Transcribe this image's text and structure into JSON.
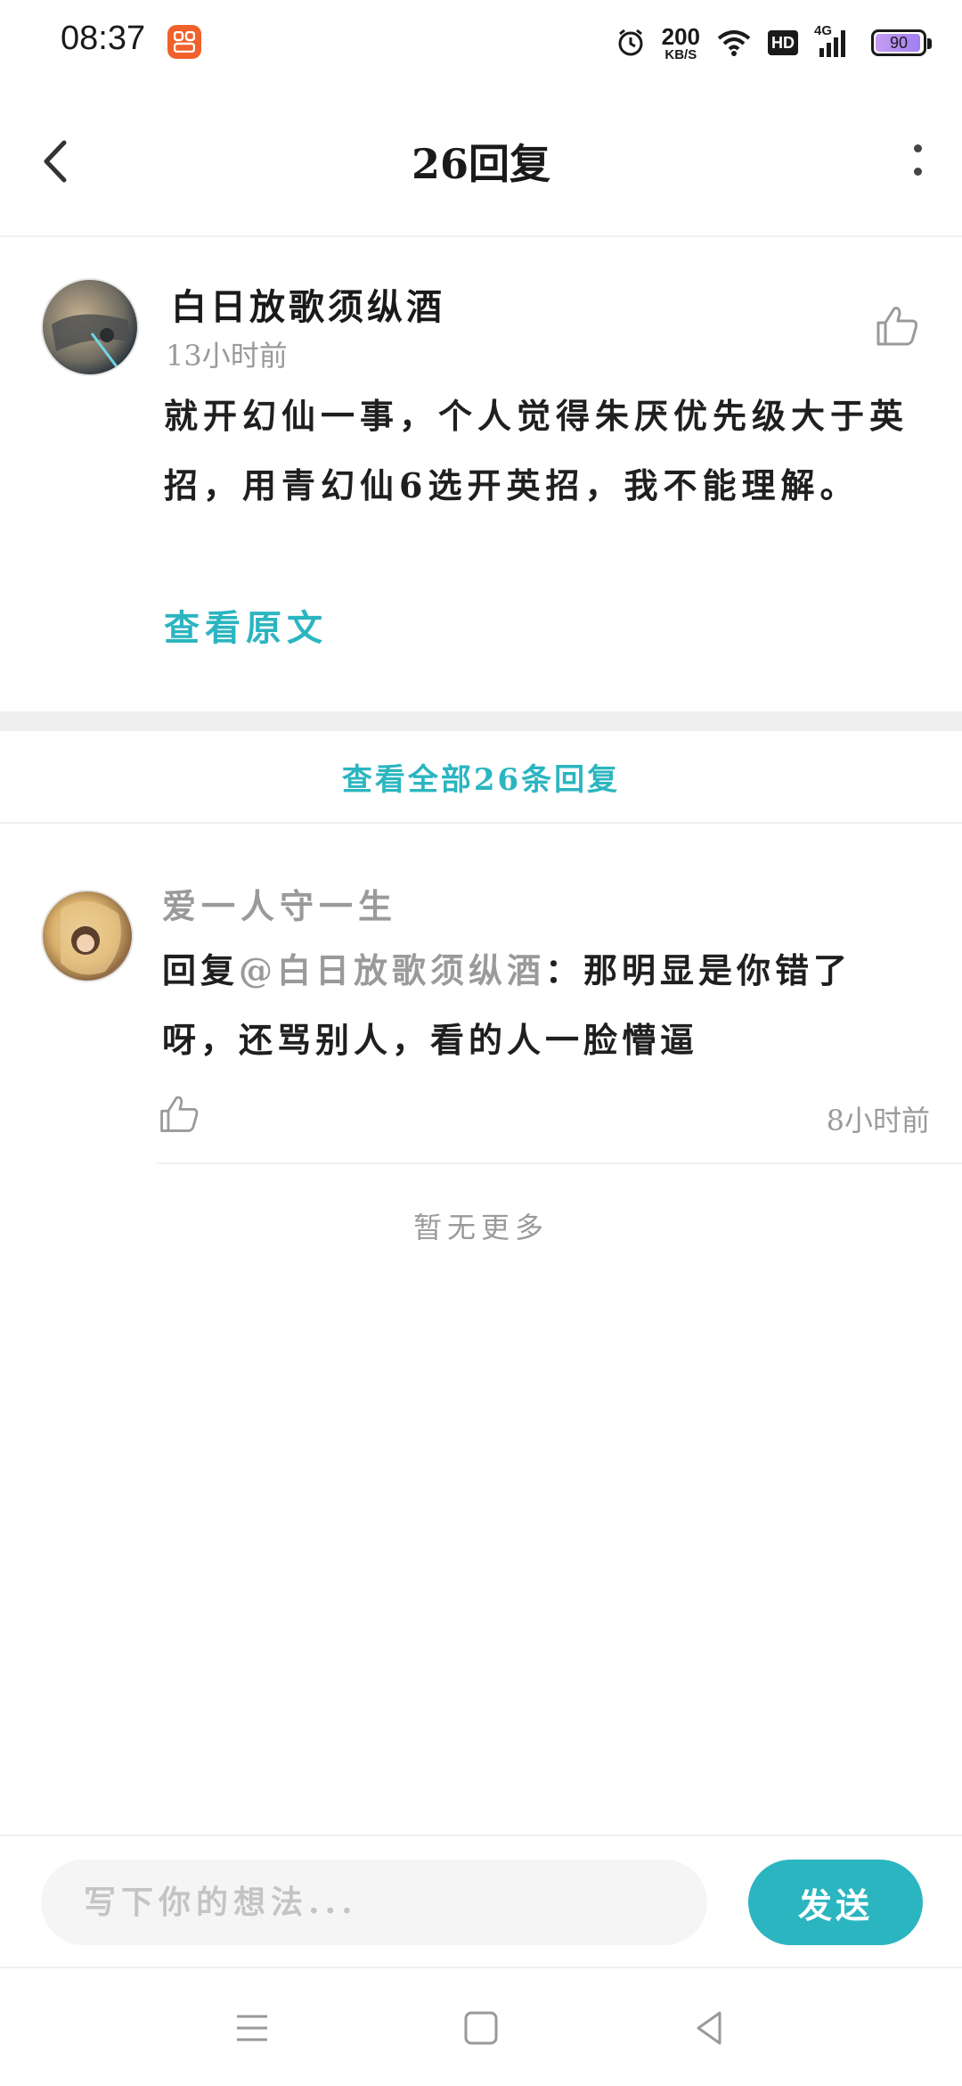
{
  "status_bar": {
    "time": "08:37",
    "net_speed_value": "200",
    "net_speed_unit": "KB/S",
    "hd_label": "HD",
    "network_type": "4G",
    "battery_level": "90"
  },
  "header": {
    "title": "26回复"
  },
  "main_comment": {
    "username": "白日放歌须纵酒",
    "time": "13小时前",
    "text": "就开幻仙一事，个人觉得朱厌优先级大于英招，用青幻仙6选开英招，我不能理解。",
    "view_original": "查看原文"
  },
  "view_all_label": "查看全部26条回复",
  "reply": {
    "username": "爱一人守一生",
    "prefix": "回复",
    "mention": "@白日放歌须纵酒",
    "text": "：那明显是你错了呀，还骂别人，看的人一脸懵逼",
    "time": "8小时前"
  },
  "no_more_label": "暂无更多",
  "input_bar": {
    "placeholder": "写下你的想法...",
    "send_label": "发送"
  },
  "colors": {
    "accent": "#2bb5c0",
    "muted": "#9a9a9a",
    "badge": "#f0612b"
  },
  "icons": [
    "back-arrow-icon",
    "more-vertical-icon",
    "thumbs-up-icon",
    "menu-icon",
    "home-square-icon",
    "back-triangle-icon",
    "alarm-icon",
    "wifi-icon",
    "signal-icon",
    "battery-icon"
  ]
}
